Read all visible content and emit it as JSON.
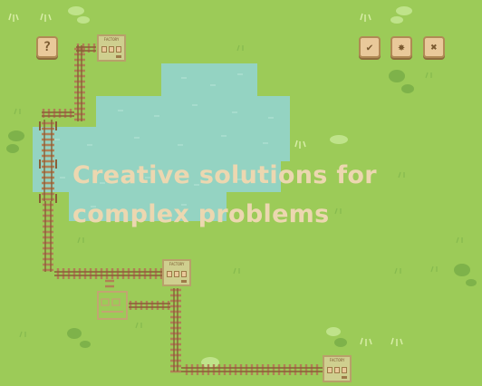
{
  "colors": {
    "grass": "#9ccb58",
    "water": "#94d3c2",
    "track": "#b08055",
    "panel": "#e9c99a",
    "headline_text": "#ecd7b0"
  },
  "toolbar": {
    "help_icon": "question-mark",
    "help_glyph": "?",
    "confirm_icon": "checkmark",
    "confirm_glyph": "✔",
    "settings_icon": "gear",
    "settings_glyph": "✸",
    "close_icon": "x-mark",
    "close_glyph": "✖"
  },
  "factories": [
    {
      "label": "FACTORY"
    },
    {
      "label": "FACTORY"
    },
    {
      "label": "FACTORY"
    }
  ],
  "headline": {
    "line1": "Creative solutions for",
    "line2": "complex problems"
  }
}
